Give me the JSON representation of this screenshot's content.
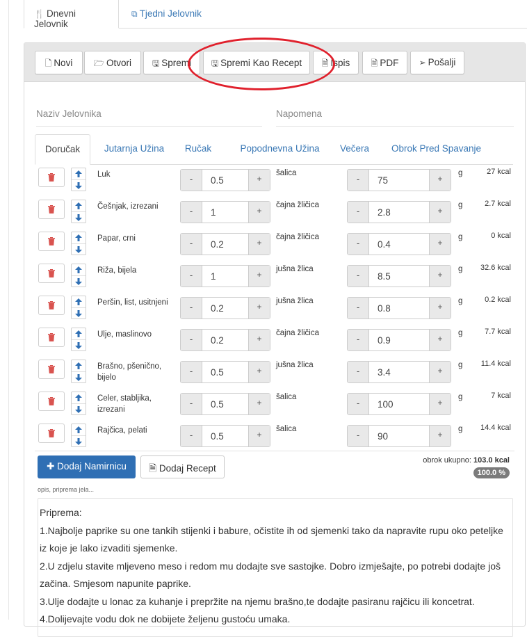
{
  "top_tabs": [
    {
      "label": "Dnevni Jelovnik",
      "icon": "cutlery-icon",
      "active": true
    },
    {
      "label": "Tjedni Jelovnik",
      "icon": "copy-icon",
      "active": false
    }
  ],
  "toolbar": {
    "new_label": "Novi",
    "open_label": "Otvori",
    "save_label": "Spremi",
    "save_as_recipe_label": "Spremi Kao Recept",
    "print_label": "Ispis",
    "pdf_label": "PDF",
    "send_label": "Pošalji"
  },
  "fields": {
    "menu_name_placeholder": "Naziv Jelovnika",
    "note_placeholder": "Napomena"
  },
  "meal_tabs": [
    {
      "label": "Doručak",
      "active": true
    },
    {
      "label": "Jutarnja Užina",
      "active": false
    },
    {
      "label": "Ručak",
      "active": false
    },
    {
      "label": "Popodnevna Užina",
      "active": false
    },
    {
      "label": "Večera",
      "active": false
    },
    {
      "label": "Obrok Pred Spavanje",
      "active": false
    }
  ],
  "ingredients": [
    {
      "name": "Luk",
      "qty": "0.5",
      "unit": "šalica",
      "grams": "75",
      "gunit": "g",
      "kcal": "27 kcal"
    },
    {
      "name": "Češnjak, izrezani",
      "qty": "1",
      "unit": "čajna žličica",
      "grams": "2.8",
      "gunit": "g",
      "kcal": "2.7 kcal"
    },
    {
      "name": "Papar, crni",
      "qty": "0.2",
      "unit": "čajna žličica",
      "grams": "0.4",
      "gunit": "g",
      "kcal": "0 kcal"
    },
    {
      "name": "Riža, bijela",
      "qty": "1",
      "unit": "jušna žlica",
      "grams": "8.5",
      "gunit": "g",
      "kcal": "32.6 kcal"
    },
    {
      "name": "Peršin, list, usitnjeni",
      "qty": "0.2",
      "unit": "jušna žlica",
      "grams": "0.8",
      "gunit": "g",
      "kcal": "0.2 kcal"
    },
    {
      "name": "Ulje, maslinovo",
      "qty": "0.2",
      "unit": "čajna žličica",
      "grams": "0.9",
      "gunit": "g",
      "kcal": "7.7 kcal"
    },
    {
      "name": "Brašno, pšenično, bijelo",
      "qty": "0.5",
      "unit": "jušna žlica",
      "grams": "3.4",
      "gunit": "g",
      "kcal": "11.4 kcal"
    },
    {
      "name": "Celer, stabljika, izrezani",
      "qty": "0.5",
      "unit": "šalica",
      "grams": "100",
      "gunit": "g",
      "kcal": "7 kcal"
    },
    {
      "name": "Rajčica, pelati",
      "qty": "0.5",
      "unit": "šalica",
      "grams": "90",
      "gunit": "g",
      "kcal": "14.4 kcal"
    }
  ],
  "stepper": {
    "minus": "-",
    "plus": "+"
  },
  "actions": {
    "add_ingredient_label": "Dodaj Namirnicu",
    "add_recipe_label": "Dodaj Recept"
  },
  "summary": {
    "total_label": "obrok ukupno:",
    "total_value": "103.0 kcal",
    "percent": "100.0 %"
  },
  "description": {
    "label": "opis, priprema jela...",
    "lines": [
      "Priprema:",
      "1.Najbolje paprike su one tankih stijenki i babure, očistite ih od sjemenki tako da napravite rupu oko peteljke",
      "iz koje je lako izvaditi sjemenke.",
      "2.U zdjelu stavite mljeveno meso i redom mu dodajte sve sastojke. Dobro izmješajte, po potrebi dodajte još",
      "začina. Smjesom napunite paprike.",
      "3.Ulje dodajte u lonac za kuhanje i prepržite na njemu brašno,te dodajte pasiranu rajčicu ili koncetrat.",
      "4.Dolijevajte vodu dok ne dobijete željenu gustoću umaka."
    ]
  },
  "colors": {
    "accent_blue": "#2f6fb4",
    "link_blue": "#3a78b5",
    "trash_red": "#d9534f",
    "annotation_red": "#e0202c"
  }
}
